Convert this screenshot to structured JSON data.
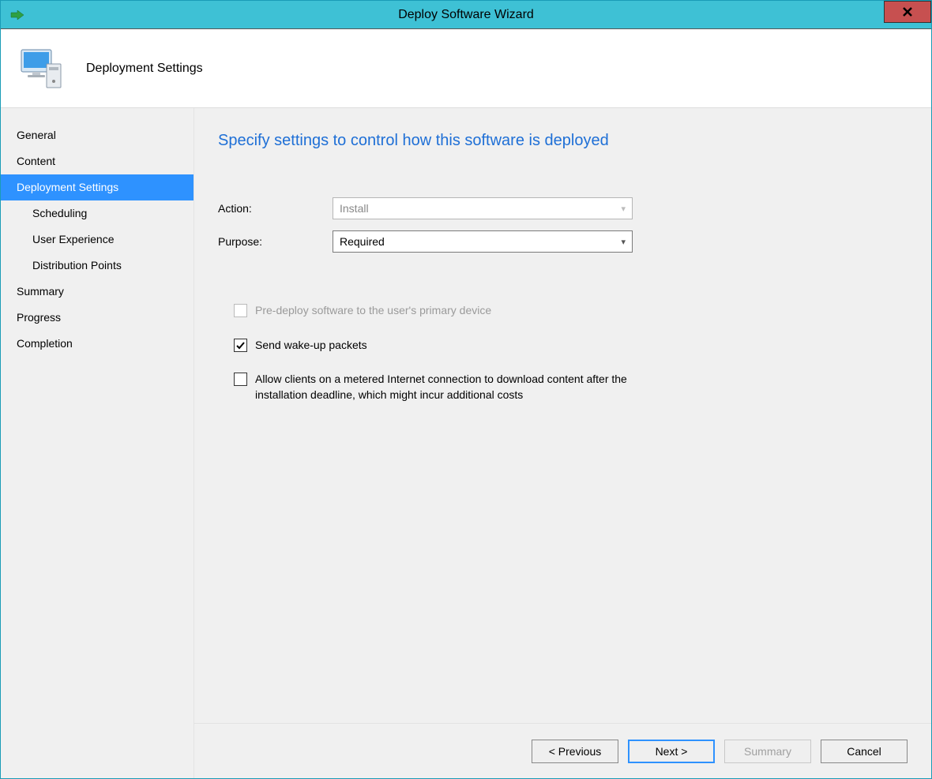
{
  "titlebar": {
    "title": "Deploy Software Wizard"
  },
  "header": {
    "title": "Deployment Settings"
  },
  "sidebar": {
    "items": [
      {
        "label": "General",
        "selected": false,
        "indent": false
      },
      {
        "label": "Content",
        "selected": false,
        "indent": false
      },
      {
        "label": "Deployment Settings",
        "selected": true,
        "indent": false
      },
      {
        "label": "Scheduling",
        "selected": false,
        "indent": true
      },
      {
        "label": "User Experience",
        "selected": false,
        "indent": true
      },
      {
        "label": "Distribution Points",
        "selected": false,
        "indent": true
      },
      {
        "label": "Summary",
        "selected": false,
        "indent": false
      },
      {
        "label": "Progress",
        "selected": false,
        "indent": false
      },
      {
        "label": "Completion",
        "selected": false,
        "indent": false
      }
    ]
  },
  "main": {
    "heading": "Specify settings to control how this software is deployed",
    "action_label": "Action:",
    "action_value": "Install",
    "purpose_label": "Purpose:",
    "purpose_value": "Required",
    "check_predeploy": "Pre-deploy software to the user's primary device",
    "check_wakeup": "Send wake-up packets",
    "check_metered": "Allow clients on a metered Internet connection to download content after the installation deadline, which might incur additional costs"
  },
  "footer": {
    "previous": "< Previous",
    "next": "Next >",
    "summary": "Summary",
    "cancel": "Cancel"
  }
}
